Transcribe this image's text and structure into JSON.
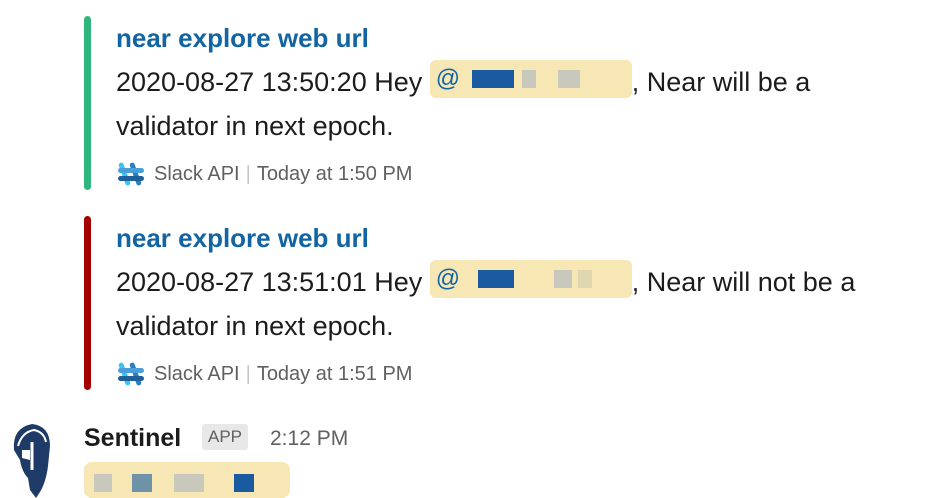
{
  "attachments": [
    {
      "title": "near explore web url",
      "text_prefix": "2020-08-27 13:50:20 Hey ",
      "mention_symbol": "@",
      "text_after_mention": ", Near will be a",
      "text_line2": "validator in next epoch.",
      "source": "Slack API",
      "separator": "|",
      "timestamp": "Today at 1:50 PM",
      "bar_color": "#2eb67d"
    },
    {
      "title": "near explore web url",
      "text_prefix": "2020-08-27 13:51:01 Hey ",
      "mention_symbol": "@",
      "text_after_mention": ", Near will not be a",
      "text_line2": "validator in next epoch.",
      "source": "Slack API",
      "separator": "|",
      "timestamp": "Today at 1:51 PM",
      "bar_color": "#a30200"
    }
  ],
  "message": {
    "sender": "Sentinel",
    "badge": "APP",
    "time": "2:12 PM",
    "avatar_icon": "spartan-helmet-icon"
  },
  "colors": {
    "link": "#1264a3",
    "mention_bg": "#f7e7b4",
    "redaction_blue": "#1a5aa0",
    "redaction_grey": "#c9c8bd"
  }
}
